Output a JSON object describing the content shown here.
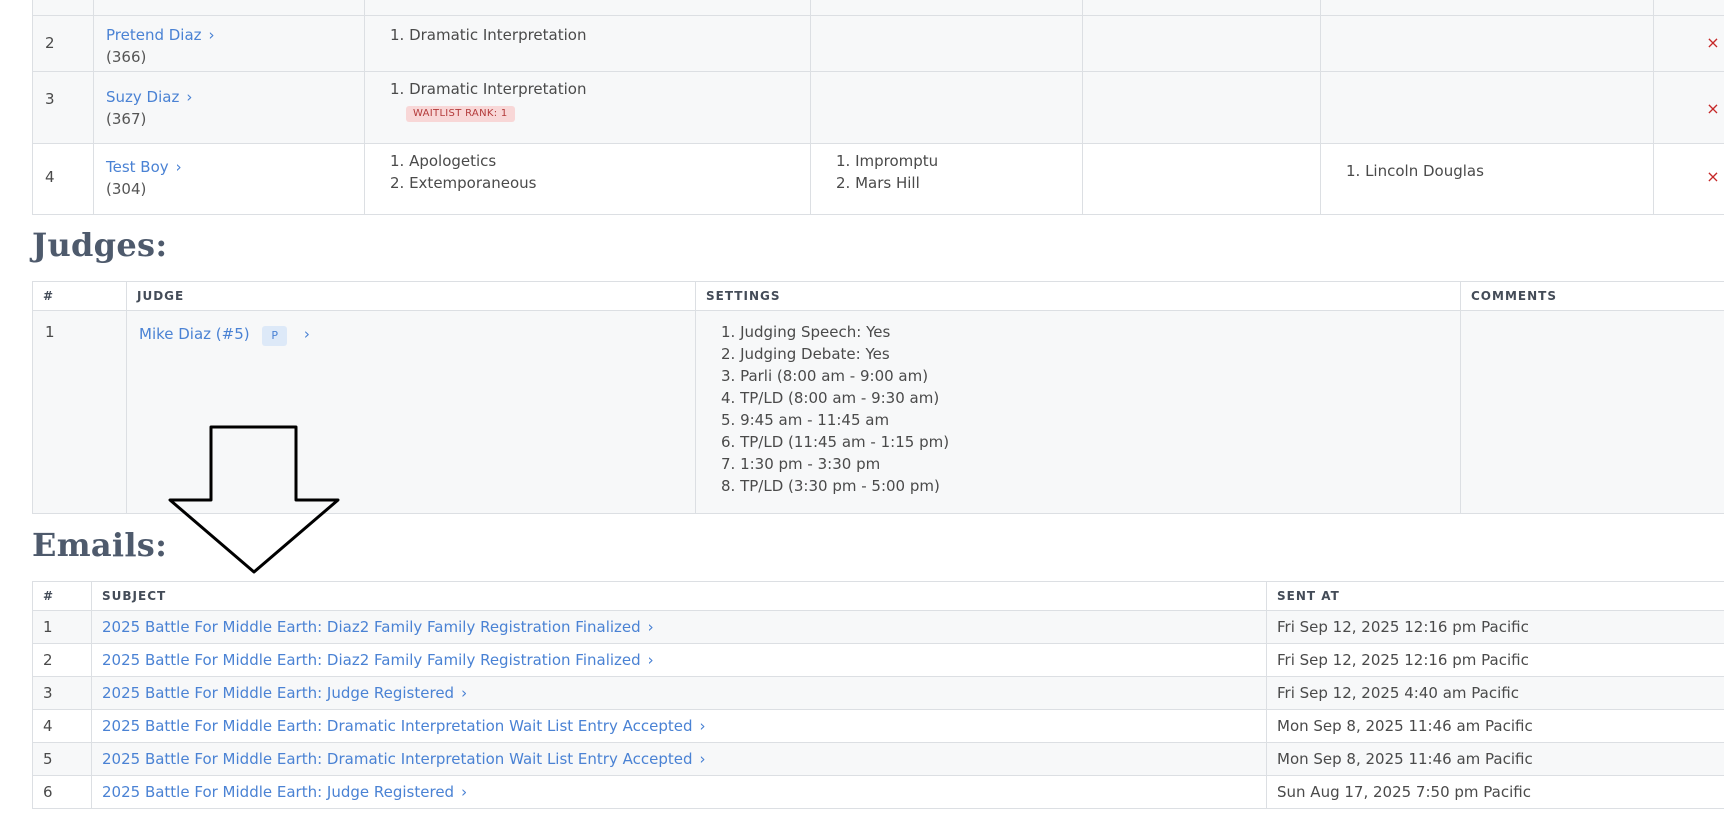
{
  "entries": {
    "rows": [
      {
        "num": "2",
        "name": "Pretend Diaz",
        "id": "(366)",
        "events": [
          "1. Dramatic Interpretation"
        ],
        "waitlist": "",
        "col2": [],
        "col4": []
      },
      {
        "num": "3",
        "name": "Suzy Diaz",
        "id": "(367)",
        "events": [
          "1. Dramatic Interpretation"
        ],
        "waitlist": "WAITLIST RANK: 1",
        "col2": [],
        "col4": []
      },
      {
        "num": "4",
        "name": "Test Boy",
        "id": "(304)",
        "events": [
          "1. Apologetics",
          "2. Extemporaneous"
        ],
        "waitlist": "",
        "col2": [
          "1. Impromptu",
          "2. Mars Hill"
        ],
        "col4": [
          "1. Lincoln Douglas"
        ]
      }
    ],
    "chevron": "›",
    "remove_icon": "×"
  },
  "judges": {
    "title": "Judges:",
    "headers": {
      "num": "#",
      "judge": "JUDGE",
      "settings": "SETTINGS",
      "comments": "COMMENTS"
    },
    "rows": [
      {
        "num": "1",
        "name": "Mike Diaz (#5)",
        "badge": "P",
        "settings": [
          "1. Judging Speech: Yes",
          "2. Judging Debate: Yes",
          "3. Parli (8:00 am - 9:00 am)",
          "4. TP/LD (8:00 am - 9:30 am)",
          "5. 9:45 am - 11:45 am",
          "6. TP/LD (11:45 am - 1:15 pm)",
          "7. 1:30 pm - 3:30 pm",
          "8. TP/LD (3:30 pm - 5:00 pm)"
        ],
        "comments": ""
      }
    ]
  },
  "emails": {
    "title": "Emails:",
    "headers": {
      "num": "#",
      "subject": "SUBJECT",
      "sent_at": "SENT AT"
    },
    "rows": [
      {
        "num": "1",
        "subject": "2025 Battle For Middle Earth: Diaz2 Family Family Registration Finalized",
        "sent": "Fri Sep 12, 2025 12:16 pm Pacific"
      },
      {
        "num": "2",
        "subject": "2025 Battle For Middle Earth: Diaz2 Family Family Registration Finalized",
        "sent": "Fri Sep 12, 2025 12:16 pm Pacific"
      },
      {
        "num": "3",
        "subject": "2025 Battle For Middle Earth: Judge Registered",
        "sent": "Fri Sep 12, 2025 4:40 am Pacific"
      },
      {
        "num": "4",
        "subject": "2025 Battle For Middle Earth: Dramatic Interpretation Wait List Entry Accepted",
        "sent": "Mon Sep 8, 2025 11:46 am Pacific"
      },
      {
        "num": "5",
        "subject": "2025 Battle For Middle Earth: Dramatic Interpretation Wait List Entry Accepted",
        "sent": "Mon Sep 8, 2025 11:46 am Pacific"
      },
      {
        "num": "6",
        "subject": "2025 Battle For Middle Earth: Judge Registered",
        "sent": "Sun Aug 17, 2025 7:50 pm Pacific"
      }
    ]
  },
  "annotation": {
    "icon": "down-arrow-icon",
    "stroke_color": "#000000"
  }
}
